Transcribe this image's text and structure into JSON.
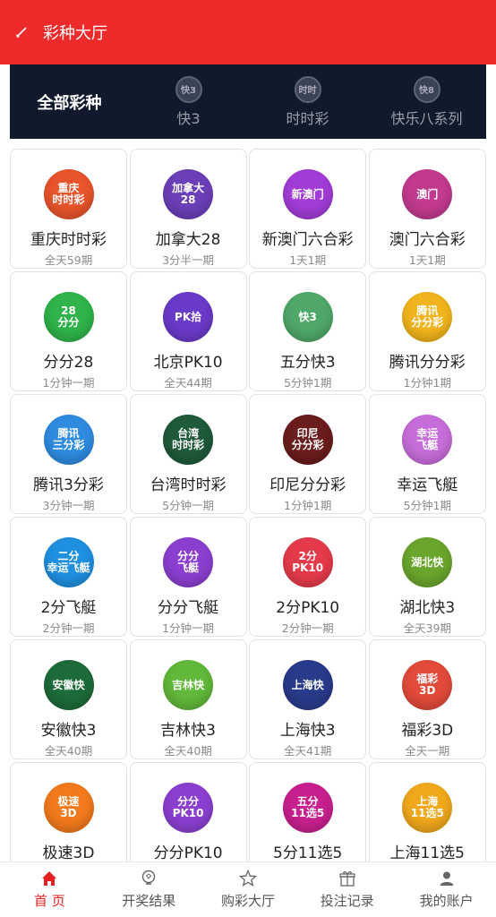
{
  "header": {
    "title": "彩种大厅",
    "back_icon": "pencil-back-icon"
  },
  "category_tabs": [
    {
      "label": "全部彩种",
      "icon": ""
    },
    {
      "label": "快3",
      "icon": "k3-logo-icon",
      "icon_text": "快3"
    },
    {
      "label": "时时彩",
      "icon": "ssc-logo-icon",
      "icon_text": "时时"
    },
    {
      "label": "快乐八系列",
      "icon": "kl8-logo-icon",
      "icon_text": "快8"
    }
  ],
  "lotteries": [
    {
      "name": "重庆时时彩",
      "period": "全天59期",
      "logo_text": "重庆\n时时彩",
      "color": "#e8542b"
    },
    {
      "name": "加拿大28",
      "period": "3分半一期",
      "logo_text": "加拿大\n28",
      "color": "#6b3fb8"
    },
    {
      "name": "新澳门六合彩",
      "period": "1天1期",
      "logo_text": "新澳门",
      "color": "#a23cd6"
    },
    {
      "name": "澳门六合彩",
      "period": "1天1期",
      "logo_text": "澳门",
      "color": "#c23a8e"
    },
    {
      "name": "分分28",
      "period": "1分钟一期",
      "logo_text": "28\n分分",
      "color": "#2fb34a"
    },
    {
      "name": "北京PK10",
      "period": "全天44期",
      "logo_text": "PK拾",
      "color": "#6a3ac9"
    },
    {
      "name": "五分快3",
      "period": "5分钟1期",
      "logo_text": "快3",
      "color": "#4fa86a"
    },
    {
      "name": "腾讯分分彩",
      "period": "1分钟1期",
      "logo_text": "腾讯\n分分彩",
      "color": "#f0b41c"
    },
    {
      "name": "腾讯3分彩",
      "period": "3分钟一期",
      "logo_text": "腾讯\n三分彩",
      "color": "#2f8be0"
    },
    {
      "name": "台湾时时彩",
      "period": "5分钟一期",
      "logo_text": "台湾\n时时彩",
      "color": "#1f5a3a"
    },
    {
      "name": "印尼分分彩",
      "period": "1分钟1期",
      "logo_text": "印尼\n分分彩",
      "color": "#6b1c1c"
    },
    {
      "name": "幸运飞艇",
      "period": "5分钟1期",
      "logo_text": "幸运\n飞艇",
      "color": "#c76dd9"
    },
    {
      "name": "2分飞艇",
      "period": "2分钟一期",
      "logo_text": "二分\n幸运飞艇",
      "color": "#1f8fe0"
    },
    {
      "name": "分分飞艇",
      "period": "1分钟一期",
      "logo_text": "分分\n飞艇",
      "color": "#8b3fd0"
    },
    {
      "name": "2分PK10",
      "period": "2分钟一期",
      "logo_text": "2分\nPK10",
      "color": "#e53a4a"
    },
    {
      "name": "湖北快3",
      "period": "全天39期",
      "logo_text": "湖北快",
      "color": "#6aa52c"
    },
    {
      "name": "安徽快3",
      "period": "全天40期",
      "logo_text": "安徽快",
      "color": "#1d6b3a"
    },
    {
      "name": "吉林快3",
      "period": "全天40期",
      "logo_text": "吉林快",
      "color": "#62b83a"
    },
    {
      "name": "上海快3",
      "period": "全天41期",
      "logo_text": "上海快",
      "color": "#2a3a8a"
    },
    {
      "name": "福彩3D",
      "period": "全天一期",
      "logo_text": "福彩\n3D",
      "color": "#e24a3a"
    },
    {
      "name": "极速3D",
      "period": "",
      "logo_text": "极速\n3D",
      "color": "#f27a1c"
    },
    {
      "name": "分分PK10",
      "period": "",
      "logo_text": "分分\nPK10",
      "color": "#8b3fd0"
    },
    {
      "name": "5分11选5",
      "period": "",
      "logo_text": "五分\n11选5",
      "color": "#c8208e"
    },
    {
      "name": "上海11选5",
      "period": "",
      "logo_text": "上海\n11选5",
      "color": "#f0a81c"
    }
  ],
  "bottom_nav": [
    {
      "label": "首 页",
      "icon": "home-icon"
    },
    {
      "label": "开奖结果",
      "icon": "trophy-icon"
    },
    {
      "label": "购彩大厅",
      "icon": "star-icon"
    },
    {
      "label": "投注记录",
      "icon": "gift-icon"
    },
    {
      "label": "我的账户",
      "icon": "user-icon"
    }
  ],
  "colors": {
    "header_bg": "#ee2a2a",
    "tabs_bg": "#111a2c",
    "active_nav": "#e62020"
  }
}
